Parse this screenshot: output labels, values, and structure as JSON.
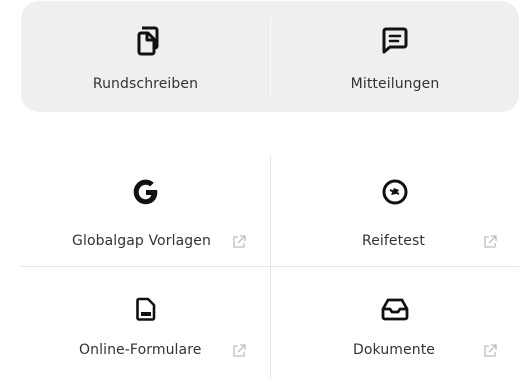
{
  "top_card": {
    "items": [
      {
        "label": "Rundschreiben",
        "icon": "copy-documents-icon"
      },
      {
        "label": "Mitteilungen",
        "icon": "message-icon"
      }
    ]
  },
  "grid": {
    "items": [
      {
        "label": "Globalgap Vorlagen",
        "icon": "google-g-icon",
        "external": true
      },
      {
        "label": "Reifetest",
        "icon": "reifetest-circle-icon",
        "external": true
      },
      {
        "label": "Online-Formulare",
        "icon": "document-form-icon",
        "external": true
      },
      {
        "label": "Dokumente",
        "icon": "inbox-tray-icon",
        "external": true
      }
    ],
    "external_icon": "external-link-icon"
  },
  "colors": {
    "card_background": "#efefef",
    "text": "#333333",
    "icon": "#111111",
    "external_icon": "#bdbdbd",
    "divider": "#e6e6e6"
  }
}
